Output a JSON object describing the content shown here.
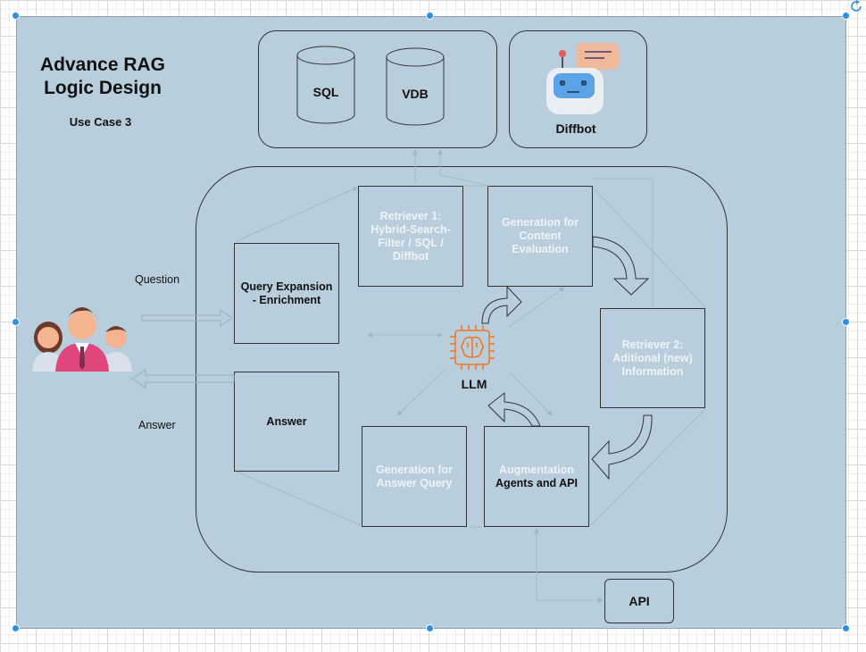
{
  "diagram": {
    "title_line1": "Advance RAG",
    "title_line2": "Logic Design",
    "subtitle": "Use Case 3",
    "data_sources": {
      "sql": "SQL",
      "vdb": "VDB",
      "diffbot": "Diffbot"
    },
    "flow_labels": {
      "question": "Question",
      "answer": "Answer"
    },
    "nodes": {
      "query_expansion": "Query Expansion - Enrichment",
      "answer": "Answer",
      "retriever1": "Retriever 1: Hybrid-Search-Filter / SQL / Diffbot",
      "generation_content": "Generation for Content Evaluation",
      "retriever2": "Retriever 2: Aditional (new) Information",
      "augmentation_line1": "Augmentation",
      "augmentation_line2": "Agents and API",
      "generation_answer": "Generation for Answer Query",
      "llm": "LLM",
      "api": "API"
    },
    "icons": {
      "users": "users-group-icon",
      "robot": "robot-chat-icon",
      "llm": "brain-chip-icon",
      "database": "database-cylinder-icon"
    },
    "colors": {
      "canvas": "#b9cedc",
      "selection_handle": "#2f8fe5",
      "llm_icon": "#f07a2a",
      "light_text": "#eef3f7"
    }
  }
}
